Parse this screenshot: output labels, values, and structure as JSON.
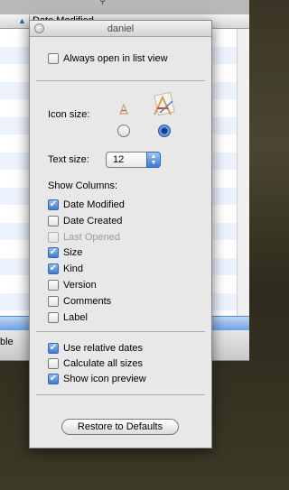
{
  "finder": {
    "column_header": "Date Modified",
    "status_text": "ble"
  },
  "panel": {
    "title": "daniel",
    "always_open_list": {
      "label": "Always open in list view",
      "checked": false
    },
    "icon_size_label": "Icon size:",
    "icon_size_options": [
      {
        "name": "small",
        "selected": false
      },
      {
        "name": "large",
        "selected": true
      }
    ],
    "text_size_label": "Text size:",
    "text_size_value": "12",
    "show_columns_label": "Show Columns:",
    "columns": [
      {
        "label": "Date Modified",
        "checked": true,
        "enabled": true
      },
      {
        "label": "Date Created",
        "checked": false,
        "enabled": true
      },
      {
        "label": "Last Opened",
        "checked": false,
        "enabled": false
      },
      {
        "label": "Size",
        "checked": true,
        "enabled": true
      },
      {
        "label": "Kind",
        "checked": true,
        "enabled": true
      },
      {
        "label": "Version",
        "checked": false,
        "enabled": true
      },
      {
        "label": "Comments",
        "checked": false,
        "enabled": true
      },
      {
        "label": "Label",
        "checked": false,
        "enabled": true
      }
    ],
    "options": [
      {
        "label": "Use relative dates",
        "checked": true
      },
      {
        "label": "Calculate all sizes",
        "checked": false
      },
      {
        "label": "Show icon preview",
        "checked": true
      }
    ],
    "restore_button": "Restore to Defaults"
  }
}
